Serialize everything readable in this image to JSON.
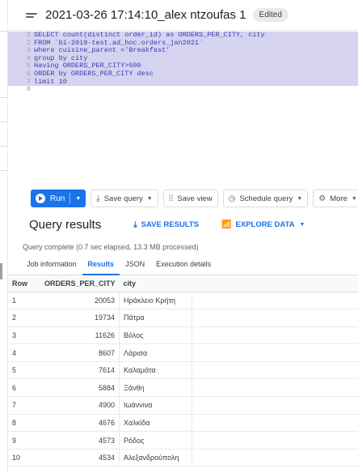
{
  "query": {
    "title": "2021-03-26 17:14:10_alex ntzoufas 1",
    "badge": "Edited"
  },
  "editor": {
    "lines": [
      {
        "n": "1",
        "text": "SELECT count(distinct order_id) as ORDERS_PER_CITY, city"
      },
      {
        "n": "2",
        "text": "FROM `bi-2019-test.ad_hoc.orders_jan2021`"
      },
      {
        "n": "3",
        "text": "where cuisine_parent ='Breakfast'"
      },
      {
        "n": "4",
        "text": "group by city"
      },
      {
        "n": "5",
        "text": "Having ORDERS_PER_CITY>500"
      },
      {
        "n": "6",
        "text": "ORDER by ORDERS_PER_CITY desc"
      },
      {
        "n": "7",
        "text": "limit 10"
      },
      {
        "n": "8",
        "text": ""
      }
    ]
  },
  "toolbar": {
    "run": "Run",
    "save_query": "Save query",
    "save_view": "Save view",
    "schedule_query": "Schedule query",
    "more": "More"
  },
  "results": {
    "title": "Query results",
    "save_results": "SAVE RESULTS",
    "explore_data": "EXPLORE DATA",
    "status": "Query complete (0.7 sec elapsed, 13.3 MB processed)",
    "tabs": [
      "Job information",
      "Results",
      "JSON",
      "Execution details"
    ],
    "columns": [
      "Row",
      "ORDERS_PER_CITY",
      "city"
    ],
    "rows": [
      [
        "1",
        "20053",
        "Ηράκλειο Κρήτη"
      ],
      [
        "2",
        "19734",
        "Πάτρα"
      ],
      [
        "3",
        "11626",
        "Βόλος"
      ],
      [
        "4",
        "8607",
        "Λάρισα"
      ],
      [
        "5",
        "7614",
        "Καλαμάτα"
      ],
      [
        "6",
        "5884",
        "Ξάνθη"
      ],
      [
        "7",
        "4900",
        "Ιωάννινα"
      ],
      [
        "8",
        "4676",
        "Χαλκίδα"
      ],
      [
        "9",
        "4573",
        "Ρόδος"
      ],
      [
        "10",
        "4534",
        "Αλεξανδρούπολη"
      ]
    ]
  },
  "colors": {
    "accent": "#1a73e8",
    "selection": "#d6d3f0"
  }
}
